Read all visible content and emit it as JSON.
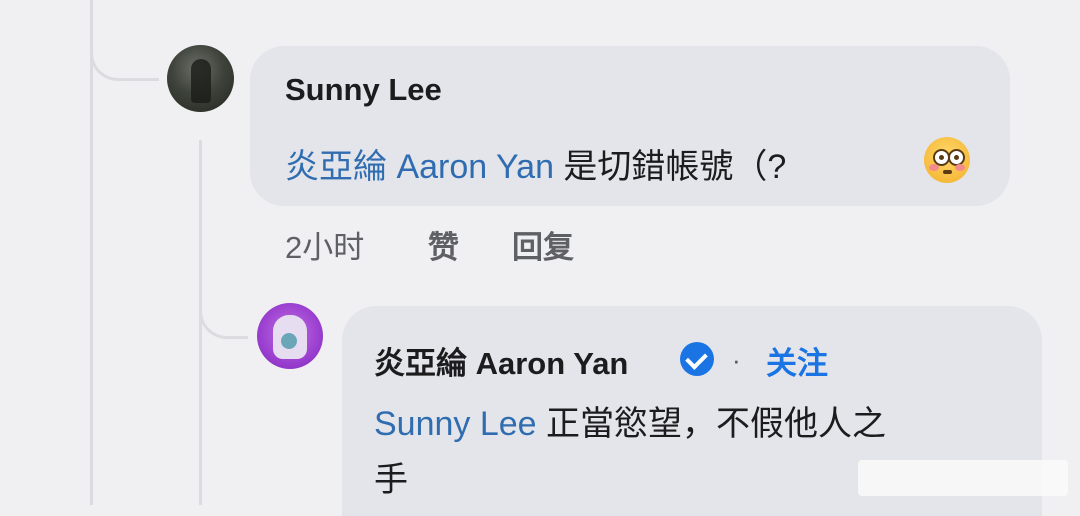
{
  "comment": {
    "author": "Sunny Lee",
    "mention": "炎亞綸 Aaron Yan",
    "text": " 是切錯帳號（? ",
    "emoji_icon": "flushed-face-emoji",
    "time": "2小时",
    "like_label": "赞",
    "reply_label": "回复"
  },
  "reply": {
    "author": "炎亞綸 Aaron Yan",
    "verified_icon": "verified-badge-icon",
    "separator": "·",
    "follow_label": "关注",
    "mention": "Sunny Lee",
    "text_line1": " 正當慾望，不假他人之",
    "text_line2": "手"
  },
  "colors": {
    "background": "#f0f0f2",
    "bubble": "#e4e5ea",
    "mention": "#2f6db0",
    "accent": "#1b74e4"
  }
}
